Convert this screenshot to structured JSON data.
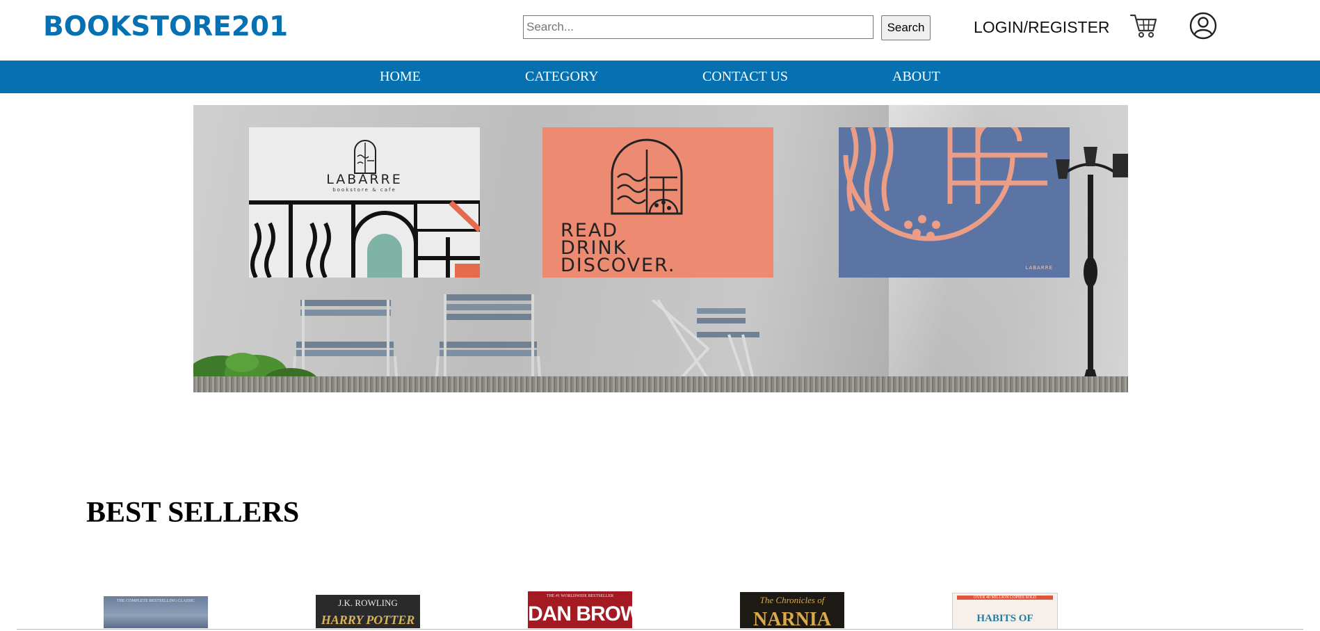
{
  "header": {
    "logo": "BOOKSTORE201",
    "search_placeholder": "Search...",
    "search_button": "Search",
    "login_label": "LOGIN/REGISTER",
    "cart_icon": "cart-icon",
    "user_icon": "user-icon"
  },
  "nav": {
    "items": [
      {
        "label": "HOME"
      },
      {
        "label": "CATEGORY"
      },
      {
        "label": "CONTACT US"
      },
      {
        "label": "ABOUT"
      }
    ]
  },
  "banner": {
    "poster_brand": "LABARRE",
    "poster_sub": "bookstore & cafe",
    "tagline": "READ\nDRINK\nDISCOVER.",
    "poster_mark": "LABARRE"
  },
  "best_sellers": {
    "title": "BEST SELLERS",
    "books": [
      {
        "top_text": "THE COMPLETE BESTSELLING CLASSIC",
        "main_text": "",
        "color": "#5c6f8e"
      },
      {
        "top_text": "J.K. ROWLING",
        "main_text": "HARRY POTTER",
        "color": "#2a2a2a"
      },
      {
        "top_text": "THE #1 WORLDWIDE BESTSELLER",
        "main_text": "DAN BROWN",
        "color": "#a31a22"
      },
      {
        "top_text": "The Chronicles of",
        "main_text": "NARNIA",
        "color": "#1d1a16"
      },
      {
        "top_text": "OVER 40 MILLION COPIES SOLD",
        "main_text": "HABITS OF",
        "color": "#f5f1ea"
      }
    ]
  },
  "colors": {
    "brand": "#0770b0",
    "nav_text": "#ffffff"
  }
}
